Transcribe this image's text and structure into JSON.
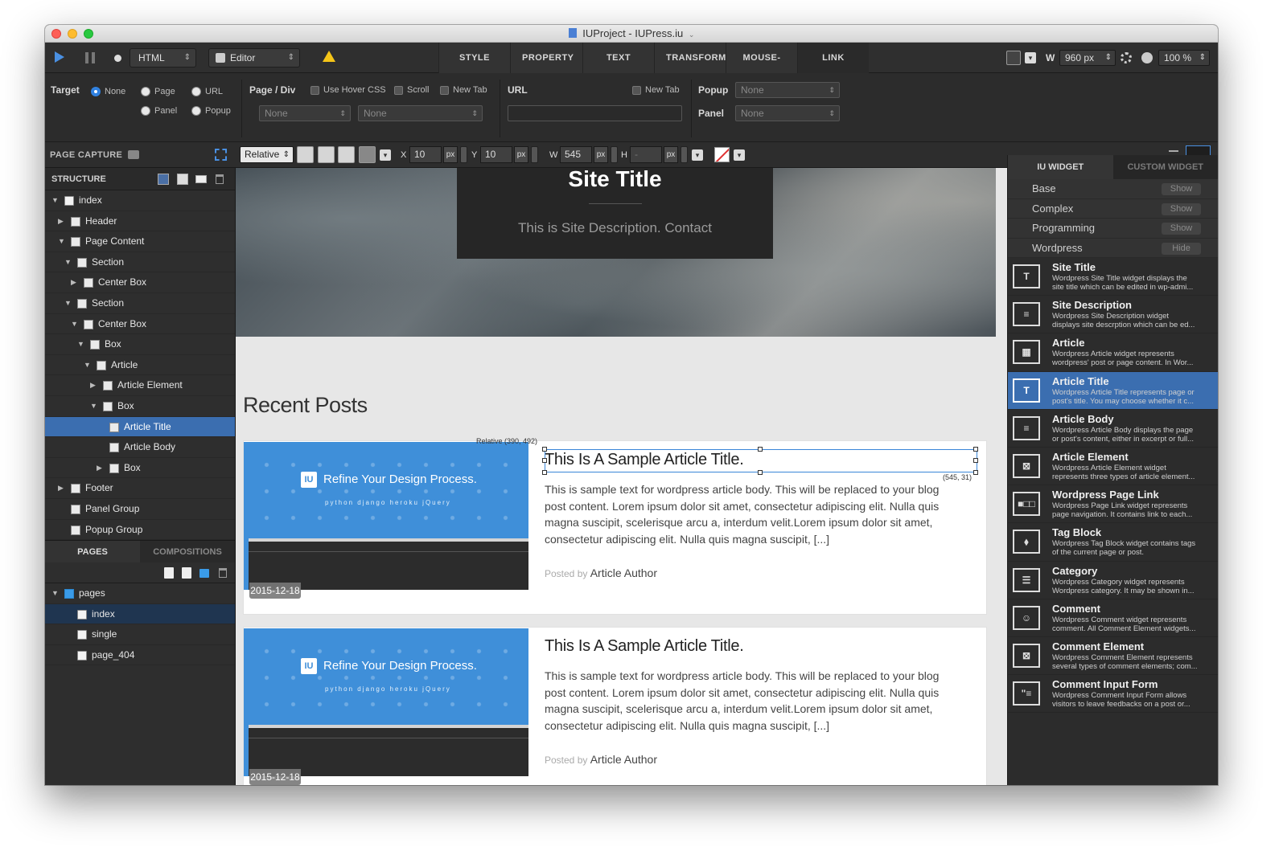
{
  "window": {
    "title": "IUProject - IUPress.iu"
  },
  "toolbar": {
    "language_select": "HTML",
    "mode_select": "Editor",
    "tabs": [
      "STYLE",
      "PROPERTY",
      "TEXT",
      "TRANSFORM",
      "MOUSE-OVER",
      "LINK"
    ],
    "width_label": "W",
    "width_value": "960 px",
    "zoom_value": "100 %"
  },
  "inspector": {
    "target_label": "Target",
    "target_options": [
      "None",
      "Page",
      "URL",
      "Panel",
      "Popup"
    ],
    "target_selected": "None",
    "page_div_label": "Page / Div",
    "use_hover_css": "Use Hover CSS",
    "scroll": "Scroll",
    "new_tab": "New Tab",
    "page_select": "None",
    "div_select": "None",
    "url_label": "URL",
    "url_new_tab": "New Tab",
    "url_value": "",
    "popup_label": "Popup",
    "popup_select": "None",
    "panel_label": "Panel",
    "panel_select": "None"
  },
  "secondary_bar": {
    "page_capture_label": "PAGE CAPTURE",
    "position_select": "Relative",
    "x_label": "X",
    "x_value": "10",
    "x_unit": "px",
    "y_label": "Y",
    "y_value": "10",
    "y_unit": "px",
    "w_label": "W",
    "w_value": "545",
    "w_unit": "px",
    "h_label": "H",
    "h_value": "-",
    "h_unit": "px"
  },
  "structure": {
    "title": "STRUCTURE",
    "items": [
      {
        "label": "index",
        "level": 0,
        "expanded": true,
        "icon": "doc-icon"
      },
      {
        "label": "Header",
        "level": 1,
        "expanded": false,
        "icon": "widget-icon"
      },
      {
        "label": "Page Content",
        "level": 1,
        "expanded": true,
        "icon": "widget-icon"
      },
      {
        "label": "Section",
        "level": 2,
        "expanded": true,
        "icon": "section-icon"
      },
      {
        "label": "Center Box",
        "level": 3,
        "expanded": false,
        "icon": "centerbox-icon"
      },
      {
        "label": "Section",
        "level": 2,
        "expanded": true,
        "icon": "section-icon"
      },
      {
        "label": "Center Box",
        "level": 3,
        "expanded": true,
        "icon": "centerbox-icon"
      },
      {
        "label": "Box",
        "level": 4,
        "expanded": true,
        "icon": "box-icon"
      },
      {
        "label": "Article",
        "level": 5,
        "expanded": true,
        "icon": "article-icon"
      },
      {
        "label": "Article Element",
        "level": 6,
        "expanded": false,
        "icon": "article-element-icon"
      },
      {
        "label": "Box",
        "level": 6,
        "expanded": true,
        "icon": "box-icon"
      },
      {
        "label": "Article Title",
        "level": 7,
        "expanded": null,
        "icon": "title-icon",
        "selected": true
      },
      {
        "label": "Article Body",
        "level": 7,
        "expanded": null,
        "icon": "body-icon"
      },
      {
        "label": "Box",
        "level": 7,
        "expanded": false,
        "icon": "box-icon"
      },
      {
        "label": "Footer",
        "level": 1,
        "expanded": false,
        "icon": "widget-icon"
      },
      {
        "label": "Panel Group",
        "level": 1,
        "expanded": null,
        "icon": "widget-icon"
      },
      {
        "label": "Popup Group",
        "level": 1,
        "expanded": null,
        "icon": "widget-icon"
      }
    ]
  },
  "pages_panel": {
    "tabs": [
      "PAGES",
      "COMPOSITIONS"
    ],
    "active_tab": "PAGES",
    "items": [
      {
        "label": "pages",
        "folder": true
      },
      {
        "label": "index",
        "selected": true
      },
      {
        "label": "single"
      },
      {
        "label": "page_404"
      }
    ]
  },
  "canvas": {
    "site_title": "Site Title",
    "site_description": "This is Site Description. Contact",
    "recent_posts": "Recent Posts",
    "selection_position": "Relative (390, 492)",
    "selection_size": "(545, 31)",
    "articles": [
      {
        "image_heading": "Refine Your Design Process.",
        "image_logo": "IU",
        "image_brands": "python  django  heroku  jQuery",
        "date": "2015-12-18",
        "title": "This Is A Sample Article Title.",
        "body": "This is sample text for wordpress article body. This will be replaced to your blog post content. Lorem ipsum dolor sit amet, consectetur adipiscing elit. Nulla quis magna suscipit, scelerisque arcu a, interdum velit.Lorem ipsum dolor sit amet, consectetur adipiscing elit. Nulla quis magna suscipit, [...]",
        "posted_by": "Posted by",
        "author": "Article Author"
      },
      {
        "image_heading": "Refine Your Design Process.",
        "image_logo": "IU",
        "image_brands": "python  django  heroku  jQuery",
        "date": "2015-12-18",
        "title": "This Is A Sample Article Title.",
        "body": "This is sample text for wordpress article body. This will be replaced to your blog post content. Lorem ipsum dolor sit amet, consectetur adipiscing elit. Nulla quis magna suscipit, scelerisque arcu a, interdum velit.Lorem ipsum dolor sit amet, consectetur adipiscing elit. Nulla quis magna suscipit, [...]",
        "posted_by": "Posted by",
        "author": "Article Author"
      }
    ]
  },
  "widget_panel": {
    "tabs": [
      "IU WIDGET",
      "CUSTOM WIDGET"
    ],
    "active_tab": "IU WIDGET",
    "categories": [
      {
        "label": "Base",
        "toggle": "Show"
      },
      {
        "label": "Complex",
        "toggle": "Show"
      },
      {
        "label": "Programming",
        "toggle": "Show"
      },
      {
        "label": "Wordpress",
        "toggle": "Hide"
      }
    ],
    "widgets": [
      {
        "name": "Site Title",
        "desc1": "Wordpress Site Title widget displays the",
        "desc2": "site title which can be edited in wp-admi...",
        "glyph": "T"
      },
      {
        "name": "Site Description",
        "desc1": "Wordpress Site Description widget",
        "desc2": "displays site descrption which can be ed...",
        "glyph": "≡"
      },
      {
        "name": "Article",
        "desc1": "Wordpress Article widget represents",
        "desc2": "wordpress' post or page content. In Wor...",
        "glyph": "▦"
      },
      {
        "name": "Article Title",
        "desc1": "Wordpress Article Title represents page or",
        "desc2": "post's title. You may choose whether it c...",
        "glyph": "T",
        "selected": true
      },
      {
        "name": "Article Body",
        "desc1": "Wordpress Article Body displays the page",
        "desc2": "or post's content, either in excerpt or full...",
        "glyph": "≡"
      },
      {
        "name": "Article Element",
        "desc1": "Wordpress Article Element widget",
        "desc2": "represents three types of article element...",
        "glyph": "⊠"
      },
      {
        "name": "Wordpress Page Link",
        "desc1": "Wordpress Page Link widget represents",
        "desc2": "page navigation. It contains link to each...",
        "glyph": "■□□"
      },
      {
        "name": "Tag Block",
        "desc1": "Wordpress Tag Block widget contains tags",
        "desc2": "of the current page or post.",
        "glyph": "⬧"
      },
      {
        "name": "Category",
        "desc1": "Wordpress Category widget represents",
        "desc2": "Wordpress category. It may be shown in...",
        "glyph": "☰"
      },
      {
        "name": "Comment",
        "desc1": "Wordpress Comment widget represents",
        "desc2": "comment. All Comment Element widgets...",
        "glyph": "☺"
      },
      {
        "name": "Comment Element",
        "desc1": "Wordpress Comment Element represents",
        "desc2": "several types of comment elements; com...",
        "glyph": "⊠"
      },
      {
        "name": "Comment Input Form",
        "desc1": "Wordpress Comment Input Form allows",
        "desc2": "visitors to leave feedbacks on a post or...",
        "glyph": "\"≡"
      }
    ]
  }
}
